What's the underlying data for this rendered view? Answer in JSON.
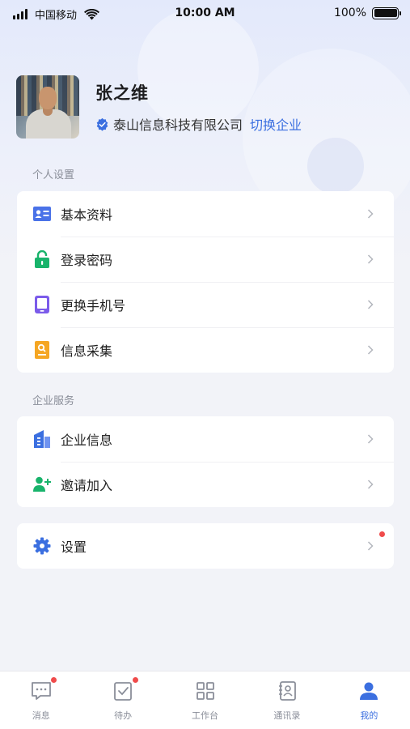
{
  "status_bar": {
    "carrier": "中国移动",
    "time": "10:00 AM",
    "battery": "100%"
  },
  "profile": {
    "name": "张之维",
    "company": "泰山信息科技有限公司",
    "switch_label": "切换企业"
  },
  "personal_settings": {
    "title": "个人设置",
    "items": [
      {
        "label": "基本资料",
        "icon": "id-card-icon"
      },
      {
        "label": "登录密码",
        "icon": "lock-icon"
      },
      {
        "label": "更换手机号",
        "icon": "phone-icon"
      },
      {
        "label": "信息采集",
        "icon": "document-search-icon"
      }
    ]
  },
  "enterprise_services": {
    "title": "企业服务",
    "items": [
      {
        "label": "企业信息",
        "icon": "building-icon"
      },
      {
        "label": "邀请加入",
        "icon": "add-user-icon"
      }
    ]
  },
  "settings": {
    "label": "设置",
    "icon": "gear-icon",
    "has_badge": true
  },
  "tabbar": {
    "tabs": [
      {
        "label": "消息",
        "icon": "message-icon",
        "badge": true
      },
      {
        "label": "待办",
        "icon": "todo-icon",
        "badge": true
      },
      {
        "label": "工作台",
        "icon": "grid-icon",
        "badge": false
      },
      {
        "label": "通讯录",
        "icon": "contacts-icon",
        "badge": false
      },
      {
        "label": "我的",
        "icon": "user-icon",
        "badge": false,
        "active": true
      }
    ]
  },
  "colors": {
    "accent": "#3b6fe0",
    "badge": "#f04b4b"
  }
}
